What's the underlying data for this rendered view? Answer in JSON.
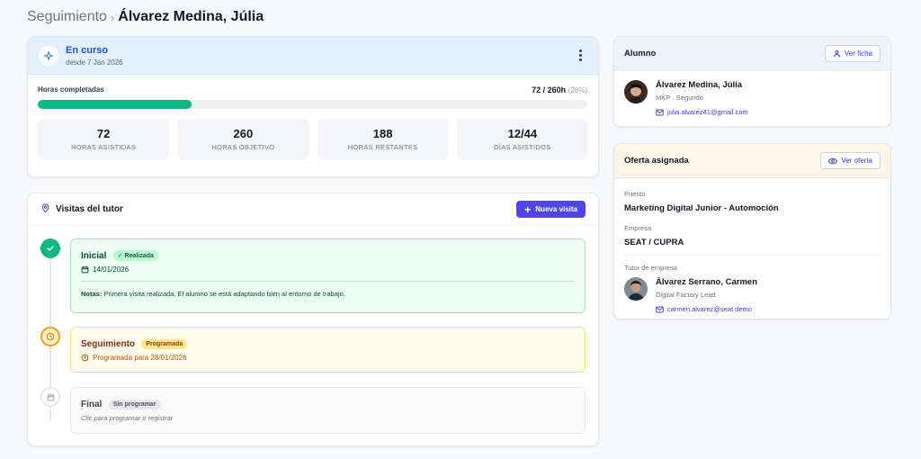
{
  "breadcrumb": {
    "parent": "Seguimiento",
    "separator": "›",
    "current": "Álvarez Medina, Júlia"
  },
  "progress": {
    "status": "En curso",
    "since": "desde 7 Jan 2026",
    "hours_label": "Horas completadas",
    "hours_value": "72 / 260h",
    "hours_pct": "(28%)",
    "fill_fraction": 0.28,
    "stats": [
      {
        "value": "72",
        "label": "HORAS ASISTIDAS"
      },
      {
        "value": "260",
        "label": "HORAS OBJETIVO"
      },
      {
        "value": "188",
        "label": "HORAS RESTANTES"
      },
      {
        "value": "12/44",
        "label": "DÍAS ASISTIDOS"
      }
    ]
  },
  "visits": {
    "title": "Visitas del tutor",
    "new_button": "Nueva visita",
    "items": [
      {
        "title": "Inicial",
        "badge": "✓ Realizada",
        "date": "14/01/2026",
        "notes_label": "Notas:",
        "notes": "Primera visita realizada. El alumno se está adaptando bien al entorno de trabajo.",
        "status_color": "#10b981"
      },
      {
        "title": "Seguimiento",
        "badge": "Programada",
        "date": "Programada para 28/01/2026",
        "status_color": "#f59e0b"
      },
      {
        "title": "Final",
        "badge": "Sin programar",
        "hint": "Clic para programar o registrar",
        "status_color": "#9ca3af"
      }
    ]
  },
  "student": {
    "title": "Alumno",
    "button": "Ver ficha",
    "name": "Álvarez Medina, Júlia",
    "program": "MKP · Segundo",
    "email": "julia.alvarez41@gmail.com"
  },
  "offer": {
    "title": "Oferta asignada",
    "button": "Ver oferta",
    "position_label": "Puesto",
    "position": "Marketing Digital Junior - Automoción",
    "company_label": "Empresa",
    "company": "SEAT / CUPRA",
    "tutor_label": "Tutor de empresa",
    "tutor_name": "Álvarez Serrano, Carmen",
    "tutor_role": "Digital Factory Lead",
    "tutor_email": "carmen.alvarez@seat.demo"
  },
  "colors": {
    "accent": "#4f46e5",
    "success": "#10b981",
    "warning": "#f59e0b"
  }
}
